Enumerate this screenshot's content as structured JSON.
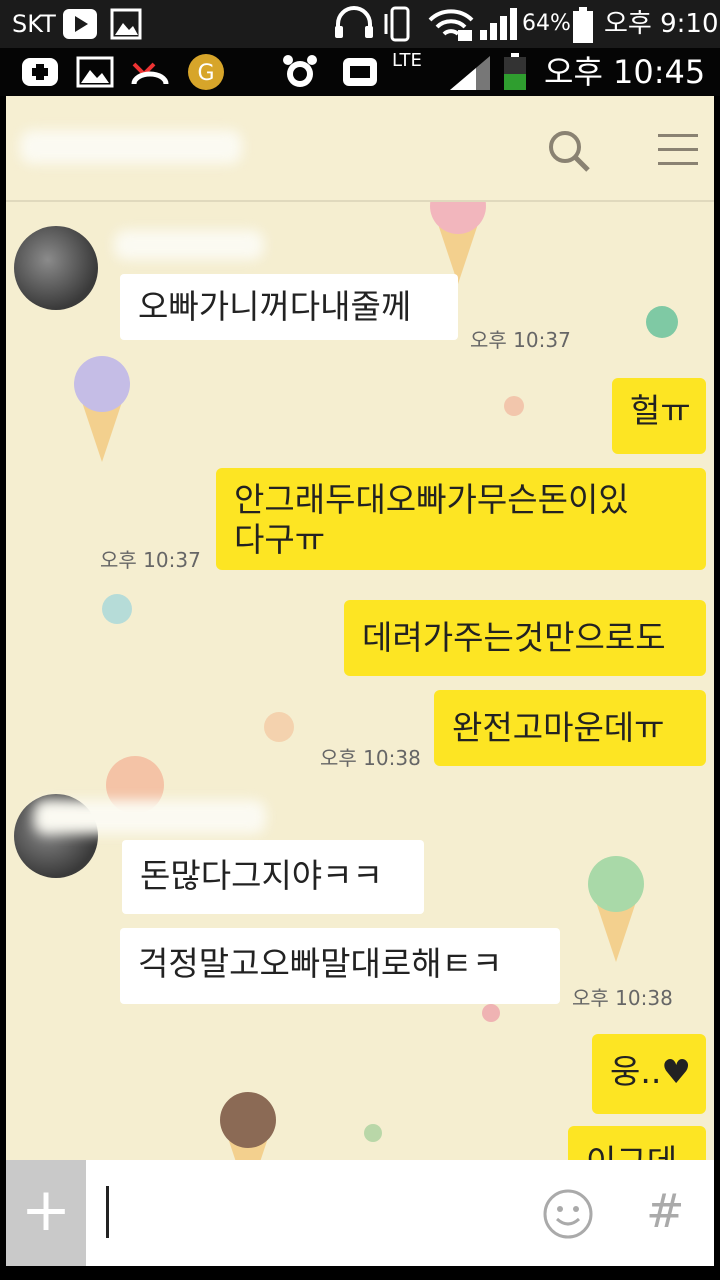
{
  "status_bar_outer": {
    "carrier": "SKT",
    "battery": "64%",
    "time": "오후 9:10"
  },
  "status_bar_inner": {
    "network": "LTE",
    "time": "오후 10:45"
  },
  "messages": [
    {
      "side": "in",
      "text": "오빠가니꺼다내줄께"
    },
    {
      "side": "out",
      "text": "헐ㅠ"
    },
    {
      "side": "out",
      "text_line1": "안그래두대오빠가무슨돈이있",
      "text_line2": "다구ㅠ"
    },
    {
      "side": "out",
      "text": "데려가주는것만으로도"
    },
    {
      "side": "out",
      "text": "완전고마운데ㅠ"
    },
    {
      "side": "in",
      "text": "돈많다그지야ㅋㅋ"
    },
    {
      "side": "in",
      "text": "걱정말고오빠말대로해ㅌㅋ"
    },
    {
      "side": "out",
      "text": "웅..♥"
    },
    {
      "side": "out",
      "text": "이그데"
    }
  ],
  "timestamps": [
    "오후 10:37",
    "오후 10:37",
    "오후 10:38",
    "오후 10:38"
  ],
  "input_bar": {
    "plus": "+",
    "hash": "#"
  },
  "colors": {
    "outgoing_bubble": "#fde523",
    "incoming_bubble": "#ffffff",
    "chat_background": "#f5eed0"
  }
}
